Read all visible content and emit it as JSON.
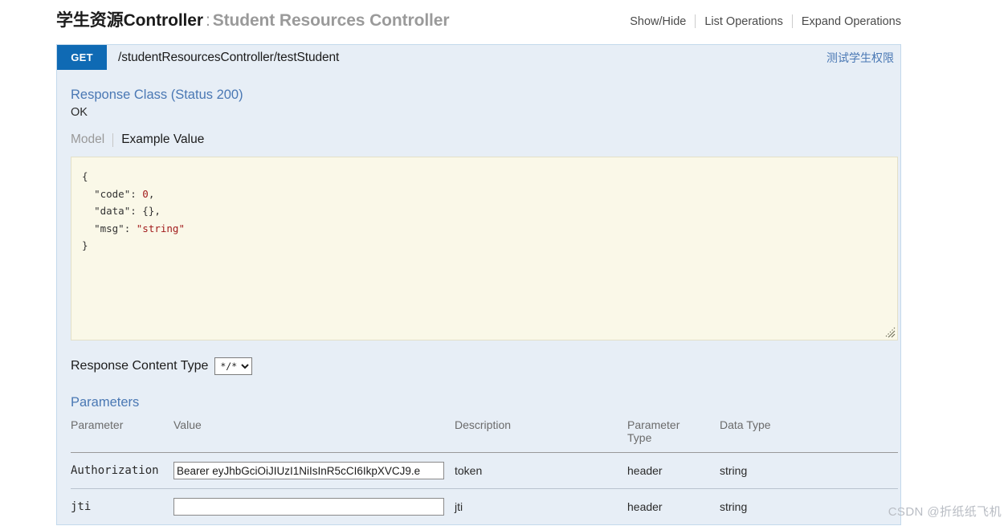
{
  "resource": {
    "title_cn": "学生资源Controller",
    "separator": ":",
    "title_en": "Student Resources Controller",
    "options": {
      "show_hide": "Show/Hide",
      "list_operations": "List Operations",
      "expand_operations": "Expand Operations"
    }
  },
  "operation": {
    "method": "GET",
    "path": "/studentResourcesController/testStudent",
    "summary": "测试学生权限",
    "response_class_title": "Response Class (Status 200)",
    "status_description": "OK",
    "tabs": {
      "model": "Model",
      "example_value": "Example Value"
    },
    "example_value": {
      "line_open": "{",
      "fields": [
        {
          "key": "\"code\"",
          "value": "0",
          "value_type": "num",
          "comma": ","
        },
        {
          "key": "\"data\"",
          "value": "{}",
          "value_type": "plain",
          "comma": ","
        },
        {
          "key": "\"msg\"",
          "value": "\"string\"",
          "value_type": "str",
          "comma": ""
        }
      ],
      "line_close": "}",
      "raw": "{\n  \"code\": 0,\n  \"data\": {},\n  \"msg\": \"string\"\n}"
    },
    "response_content_type": {
      "label": "Response Content Type",
      "selected": "*/*",
      "options": [
        "*/*"
      ]
    },
    "parameters_title": "Parameters",
    "parameters_table": {
      "columns": [
        "Parameter",
        "Value",
        "Description",
        "Parameter Type",
        "Data Type"
      ],
      "column_parameter_type_line1": "Parameter",
      "column_parameter_type_line2": "Type",
      "rows": [
        {
          "parameter": "Authorization",
          "value": "Bearer eyJhbGciOiJIUzI1NiIsInR5cCI6IkpXVCJ9.e",
          "placeholder": "",
          "description": "token",
          "parameter_type": "header",
          "data_type": "string"
        },
        {
          "parameter": "jti",
          "value": "",
          "placeholder": "",
          "description": "jti",
          "parameter_type": "header",
          "data_type": "string"
        }
      ]
    }
  },
  "watermark": "CSDN @折纸纸飞机",
  "colors": {
    "method_get": "#0f6ab4",
    "link_blue": "#4a78b4",
    "panel_bg": "#e7eef6",
    "panel_border": "#c3d9ec",
    "code_bg": "#faf8e8",
    "code_string": "#a11b1b"
  }
}
